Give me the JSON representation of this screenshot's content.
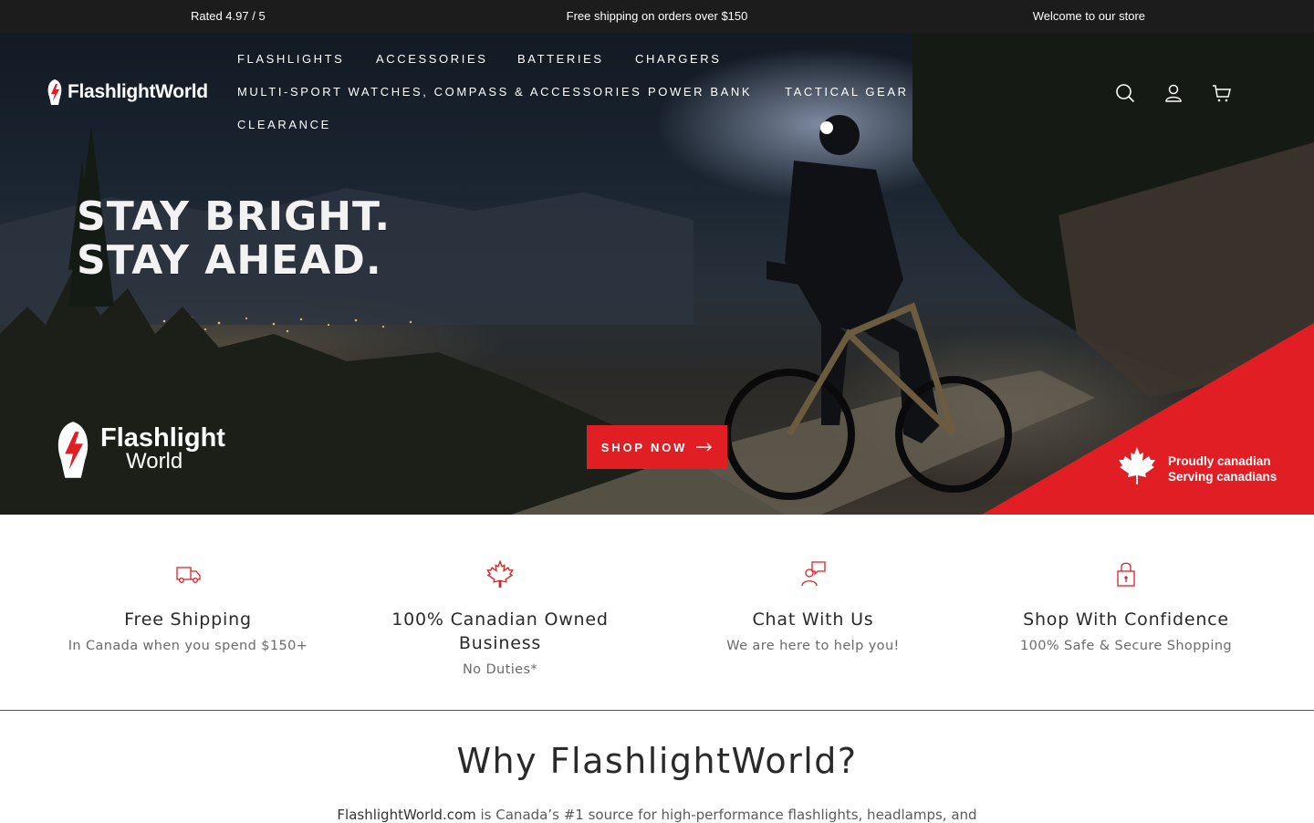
{
  "announcement": {
    "rating": "Rated 4.97 / 5",
    "shipping": "Free shipping on orders over $150",
    "welcome": "Welcome to our store"
  },
  "header": {
    "logo_text": "FlashlightWorld",
    "nav": [
      "FLASHLIGHTS",
      "ACCESSORIES",
      "BATTERIES",
      "CHARGERS",
      "MULTI-SPORT WATCHES, COMPASS & ACCESSORIES",
      "POWER BANK",
      "TACTICAL GEAR",
      "CLEARANCE"
    ],
    "icons": [
      "search-icon",
      "account-icon",
      "cart-icon"
    ]
  },
  "hero": {
    "headline_line1": "STAY BRIGHT.",
    "headline_line2": "STAY AHEAD.",
    "logo_line1": "Flashlight",
    "logo_line2": "World",
    "cta_label": "SHOP NOW",
    "badge_line1": "Proudly canadian",
    "badge_line2": "Serving canadians",
    "accent_color": "#e01e24"
  },
  "features": [
    {
      "icon": "truck-icon",
      "title": "Free Shipping",
      "subtitle": "In Canada when you spend $150+"
    },
    {
      "icon": "maple-leaf-icon",
      "title": "100% Canadian Owned Business",
      "subtitle": "No Duties*"
    },
    {
      "icon": "chat-support-icon",
      "title": "Chat With Us",
      "subtitle": "We are here to help you!"
    },
    {
      "icon": "lock-icon",
      "title": "Shop With Confidence",
      "subtitle": "100% Safe & Secure Shopping"
    }
  ],
  "why": {
    "title": "Why FlashlightWorld?",
    "intro_brand": "FlashlightWorld.com",
    "intro_rest": " is Canada’s #1 source for high-performance flashlights, headlamps, and"
  }
}
